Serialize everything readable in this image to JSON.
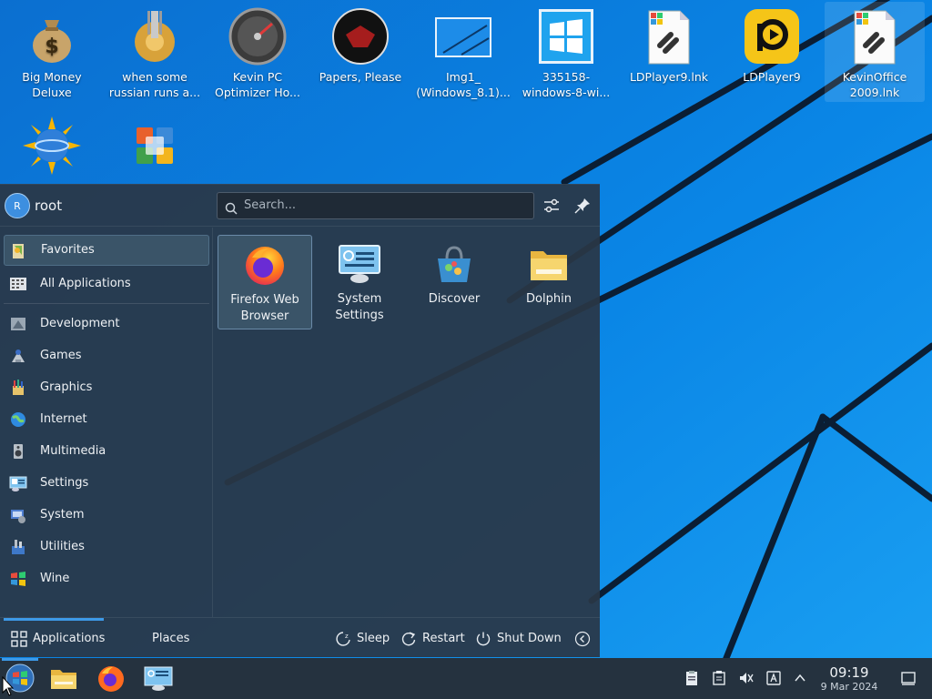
{
  "desktop": {
    "icons": [
      {
        "label": "Big Money Deluxe",
        "icon": "money-bag-icon"
      },
      {
        "label": "when some russian runs a...",
        "icon": "gear-icon"
      },
      {
        "label": "Kevin PC Optimizer Ho...",
        "icon": "speedometer-icon"
      },
      {
        "label": "Papers, Please",
        "icon": "papers-please-icon"
      },
      {
        "label": "Img1_ (Windows_8.1)...",
        "icon": "image-icon"
      },
      {
        "label": "335158-windows-8-wi...",
        "icon": "windows-logo-icon"
      },
      {
        "label": "LDPlayer9.lnk",
        "icon": "shortcut-link-icon"
      },
      {
        "label": "LDPlayer9",
        "icon": "ldplayer-icon"
      },
      {
        "label": "KevinOffice 2009.lnk",
        "icon": "shortcut-link-icon"
      },
      {
        "label": "",
        "icon": "globe-sun-icon"
      },
      {
        "label": "",
        "icon": "office-logo-icon"
      }
    ]
  },
  "menu": {
    "user_initial": "R",
    "username": "root",
    "search_placeholder": "Search...",
    "categories": [
      {
        "label": "Favorites",
        "icon": "favorites-icon"
      },
      {
        "label": "All Applications",
        "icon": "all-apps-icon"
      },
      {
        "label": "Development",
        "icon": "development-icon"
      },
      {
        "label": "Games",
        "icon": "games-icon"
      },
      {
        "label": "Graphics",
        "icon": "graphics-icon"
      },
      {
        "label": "Internet",
        "icon": "internet-icon"
      },
      {
        "label": "Multimedia",
        "icon": "multimedia-icon"
      },
      {
        "label": "Settings",
        "icon": "settings-icon"
      },
      {
        "label": "System",
        "icon": "system-icon"
      },
      {
        "label": "Utilities",
        "icon": "utilities-icon"
      },
      {
        "label": "Wine",
        "icon": "wine-icon"
      }
    ],
    "favorites": [
      {
        "label": "Firefox Web Browser",
        "icon": "firefox-icon"
      },
      {
        "label": "System Settings",
        "icon": "system-settings-icon"
      },
      {
        "label": "Discover",
        "icon": "discover-icon"
      },
      {
        "label": "Dolphin",
        "icon": "folder-icon"
      }
    ],
    "footer": {
      "applications": "Applications",
      "places": "Places",
      "sleep": "Sleep",
      "restart": "Restart",
      "shutdown": "Shut Down"
    }
  },
  "taskbar": {
    "time": "09:19",
    "date": "9 Mar 2024"
  },
  "colors": {
    "wallpaper": "#0a78d8",
    "menu_bg": "#2a3746",
    "accent": "#3d9ae8",
    "taskbar_bg": "#25323f"
  }
}
